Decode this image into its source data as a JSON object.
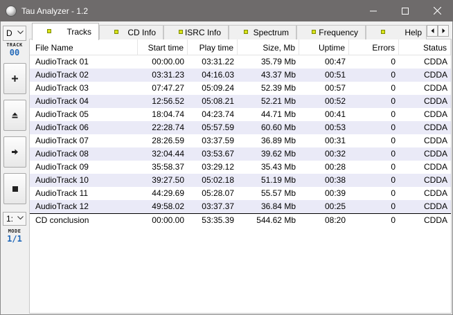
{
  "window": {
    "title": "Tau Analyzer - 1.2"
  },
  "left_panel": {
    "drive_value": "D",
    "track_label": "TRACK",
    "track_value": "00",
    "mode_select_value": "1:",
    "mode_label": "MODE",
    "mode_value": "1/1"
  },
  "tabs": [
    {
      "label": "Tracks",
      "active": true
    },
    {
      "label": "CD Info",
      "active": false
    },
    {
      "label": "ISRC Info",
      "active": false
    },
    {
      "label": "Spectrum",
      "active": false
    },
    {
      "label": "Frequency",
      "active": false
    },
    {
      "label": "Help",
      "active": false
    }
  ],
  "table": {
    "columns": [
      "File Name",
      "Start time",
      "Play time",
      "Size, Mb",
      "Uptime",
      "Errors",
      "Status"
    ],
    "rows": [
      [
        "AudioTrack 01",
        "00:00.00",
        "03:31.22",
        "35.79 Mb",
        "00:47",
        "0",
        "CDDA"
      ],
      [
        "AudioTrack 02",
        "03:31.23",
        "04:16.03",
        "43.37 Mb",
        "00:51",
        "0",
        "CDDA"
      ],
      [
        "AudioTrack 03",
        "07:47.27",
        "05:09.24",
        "52.39 Mb",
        "00:57",
        "0",
        "CDDA"
      ],
      [
        "AudioTrack 04",
        "12:56.52",
        "05:08.21",
        "52.21 Mb",
        "00:52",
        "0",
        "CDDA"
      ],
      [
        "AudioTrack 05",
        "18:04.74",
        "04:23.74",
        "44.71 Mb",
        "00:41",
        "0",
        "CDDA"
      ],
      [
        "AudioTrack 06",
        "22:28.74",
        "05:57.59",
        "60.60 Mb",
        "00:53",
        "0",
        "CDDA"
      ],
      [
        "AudioTrack 07",
        "28:26.59",
        "03:37.59",
        "36.89 Mb",
        "00:31",
        "0",
        "CDDA"
      ],
      [
        "AudioTrack 08",
        "32:04.44",
        "03:53.67",
        "39.62 Mb",
        "00:32",
        "0",
        "CDDA"
      ],
      [
        "AudioTrack 09",
        "35:58.37",
        "03:29.12",
        "35.43 Mb",
        "00:28",
        "0",
        "CDDA"
      ],
      [
        "AudioTrack 10",
        "39:27.50",
        "05:02.18",
        "51.19 Mb",
        "00:38",
        "0",
        "CDDA"
      ],
      [
        "AudioTrack 11",
        "44:29.69",
        "05:28.07",
        "55.57 Mb",
        "00:39",
        "0",
        "CDDA"
      ],
      [
        "AudioTrack 12",
        "49:58.02",
        "03:37.37",
        "36.84 Mb",
        "00:25",
        "0",
        "CDDA"
      ]
    ],
    "conclusion": [
      "CD conclusion",
      "00:00.00",
      "53:35.39",
      "544.62 Mb",
      "08:20",
      "0",
      "CDDA"
    ]
  },
  "icons": {
    "app": "app-disc-icon",
    "minimize": "minimize-icon",
    "maximize": "maximize-icon",
    "close": "close-icon",
    "add": "plus-icon",
    "eject": "eject-icon",
    "next": "arrow-right-icon",
    "stop": "stop-icon"
  },
  "colors": {
    "titlebar": "#6e6b6b",
    "alt_row": "#eaeaf7",
    "lcd_value": "#2067b8",
    "tab_led": "#d8e21a"
  }
}
